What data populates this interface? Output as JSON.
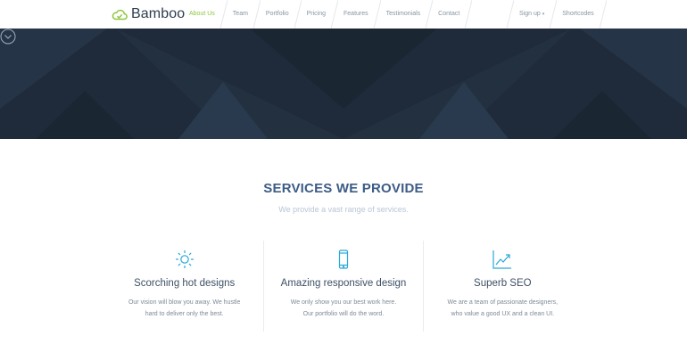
{
  "brand": {
    "name": "Bamboo",
    "logo_icon": "cloud-icon",
    "logo_color": "#8dc63f"
  },
  "nav": {
    "items": [
      {
        "label": "About Us",
        "active": true
      },
      {
        "label": "Team"
      },
      {
        "label": "Portfolio"
      },
      {
        "label": "Pricing"
      },
      {
        "label": "Features"
      },
      {
        "label": "Testimonials"
      },
      {
        "label": "Contact"
      }
    ],
    "right_items": [
      {
        "label": "Sign up",
        "has_dropdown": true
      },
      {
        "label": "Shortcodes"
      }
    ]
  },
  "hero": {
    "background": "#1f2b3a",
    "scroll_icon": "chevron-down-circle-icon"
  },
  "services": {
    "title": "SERVICES WE PROVIDE",
    "subtitle": "We provide a vast range of services.",
    "items": [
      {
        "icon": "sun-icon",
        "title": "Scorching hot designs",
        "line1": "Our vision will blow you away. We hustle",
        "line2": "hard to deliver only the best."
      },
      {
        "icon": "mobile-phone-icon",
        "title": "Amazing responsive design",
        "line1": "We only show you our best work here.",
        "line2": "Our portfolio will do the word."
      },
      {
        "icon": "chart-icon",
        "title": "Superb SEO",
        "line1": "We are a team of passionate designers,",
        "line2": "who value a good UX and a clean UI."
      }
    ],
    "accent_color": "#2aa8d8"
  }
}
